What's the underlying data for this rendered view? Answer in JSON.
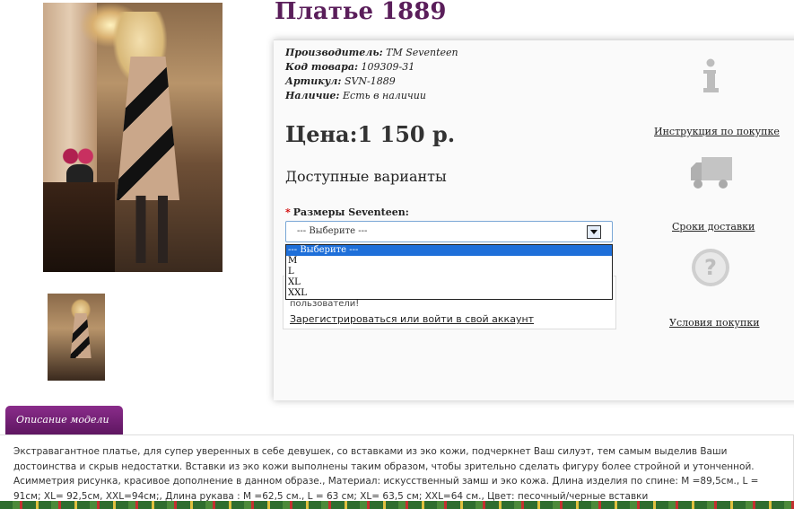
{
  "product": {
    "title": "Платье 1889",
    "meta": [
      {
        "label": "Производитель:",
        "value": "TM Seventeen"
      },
      {
        "label": "Код товара:",
        "value": "109309-31"
      },
      {
        "label": "Артикул:",
        "value": "SVN-1889"
      },
      {
        "label": "Наличие:",
        "value": "Есть в наличии"
      }
    ],
    "price": "Цена:1 150 р.",
    "variants_title": "Доступные варианты",
    "size_label": "Размеры Seventeen:",
    "required_mark": "*"
  },
  "select": {
    "value": "--- Выберите ---",
    "options": [
      "--- Выберите ---",
      "M",
      "L",
      "XL",
      "XXL"
    ],
    "selected_index": 0
  },
  "login": {
    "text": "пользователи!",
    "link": "Зарегистрироваться или войти в свой аккаунт"
  },
  "side": {
    "purchase_instructions": "Инструкция по покупке",
    "delivery_terms": "Сроки доставки",
    "purchase_conditions": "Условия покупки"
  },
  "description": {
    "tab_label": "Описание модели",
    "text": "Экстравагантное платье, для супер уверенных в себе девушек, со вставками из эко кожи, подчеркнет Ваш силуэт, тем самым выделив Ваши достоинства и скрыв недостатки. Вставки из эко кожи выполнены таким образом, чтобы зрительно сделать фигуру более стройной и утонченной. Асимметрия рисунка, красивое дополнение в данном образе., Материал: искусственный замш и эко кожа. Длина изделия по спине: M =89,5см., L = 91см; XL= 92,5см, XXL=94см;, Длина рукава : M =62,5 см., L = 63 см; XL= 63,5 см; XXL=64 см., Цвет: песочный/черные вставки"
  },
  "colors": {
    "title": "#5a1e5a",
    "tab": "#7a227a",
    "required": "#d00000",
    "select_highlight": "#1e6fd9"
  }
}
